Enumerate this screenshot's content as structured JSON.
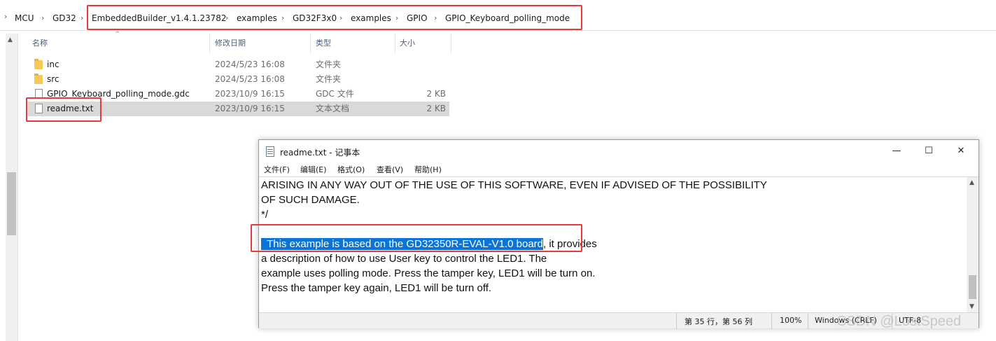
{
  "breadcrumb": {
    "items": [
      "MCU",
      "GD32",
      "EmbeddedBuilder_v1.4.1.23782",
      "examples",
      "GD32F3x0",
      "examples",
      "GPIO",
      "GPIO_Keyboard_polling_mode"
    ]
  },
  "columns": {
    "name": "名称",
    "date": "修改日期",
    "type": "类型",
    "size": "大小"
  },
  "files": [
    {
      "name": "inc",
      "date": "2024/5/23 16:08",
      "type": "文件夹",
      "size": "",
      "icon": "folder-icon"
    },
    {
      "name": "src",
      "date": "2024/5/23 16:08",
      "type": "文件夹",
      "size": "",
      "icon": "folder-icon"
    },
    {
      "name": "GPIO_Keyboard_polling_mode.gdc",
      "date": "2023/10/9 16:15",
      "type": "GDC 文件",
      "size": "2 KB",
      "icon": "file-icon"
    },
    {
      "name": "readme.txt",
      "date": "2023/10/9 16:15",
      "type": "文本文档",
      "size": "2 KB",
      "icon": "text-file-icon",
      "selected": true
    }
  ],
  "notepad": {
    "title": "readme.txt - 记事本",
    "controls": {
      "minimize": "—",
      "maximize": "☐",
      "close": "✕"
    },
    "menu": [
      "文件(F)",
      "编辑(E)",
      "格式(O)",
      "查看(V)",
      "帮助(H)"
    ],
    "lines": [
      "ARISING IN ANY WAY OUT OF THE USE OF THIS SOFTWARE, EVEN IF ADVISED OF THE POSSIBILITY",
      "OF SUCH DAMAGE.",
      "*/",
      "",
      "  This example is based on the GD32350R-EVAL-V1.0 board",
      "a description of how to use User key to control the LED1. The",
      "example uses polling mode. Press the tamper key, LED1 will be turn on.",
      "Press the tamper key again, LED1 will be turn off."
    ],
    "highlight_rest": ", it provides",
    "status": {
      "position": "第 35 行，第 56 列",
      "zoom": "100%",
      "eol": "Windows (CRLF)",
      "encoding": "UTF-8"
    }
  },
  "watermark": "CSDN @LostSpeed",
  "colors": {
    "highlight": "#0b74d7",
    "annotation_red": "#e8393d",
    "selected_row": "#d9d9d9"
  }
}
